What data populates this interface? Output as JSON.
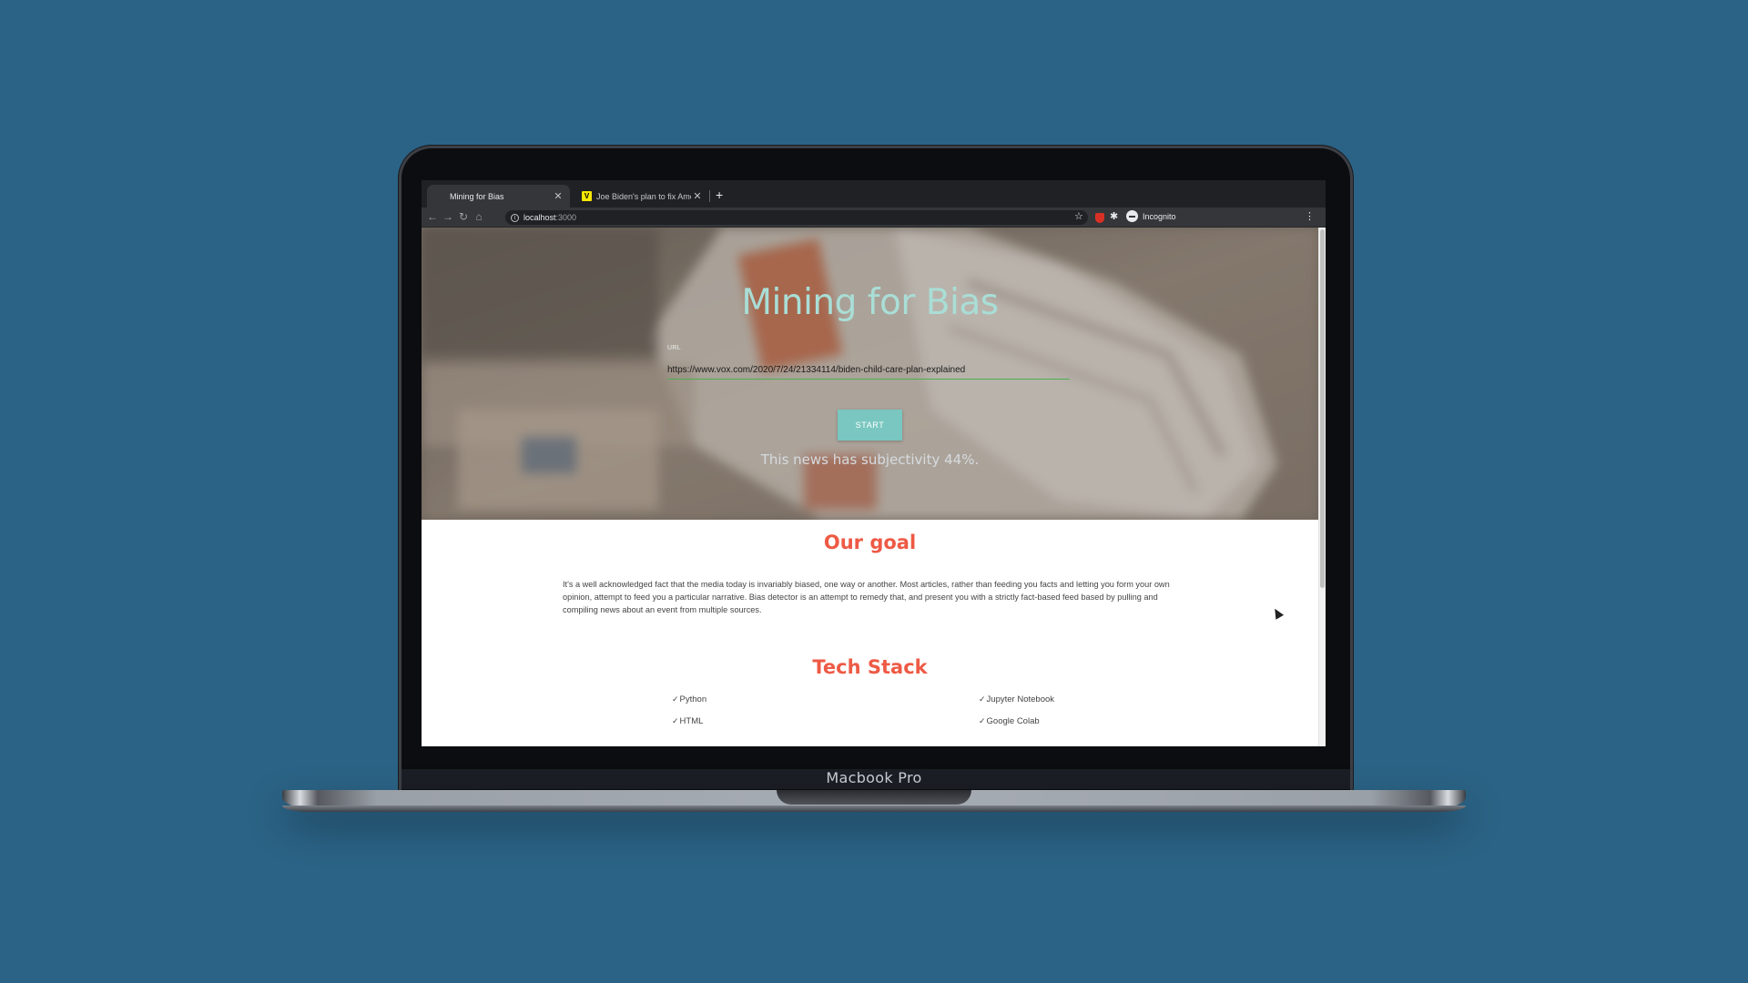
{
  "device": {
    "label": "Macbook Pro"
  },
  "browser": {
    "tabs": [
      {
        "title": "Mining for Bias",
        "active": true
      },
      {
        "title": "Joe Biden's plan to fix America's",
        "favicon": "vox-icon",
        "active": false
      }
    ],
    "address": {
      "host": "localhost",
      "port": ":3000"
    },
    "profile_label": "Incognito"
  },
  "hero": {
    "title": "Mining for Bias",
    "url_label": "URL",
    "url_value": "https://www.vox.com/2020/7/24/21334114/biden-child-care-plan-explained",
    "start_label": "START",
    "result": "This news has subjectivity 44%."
  },
  "goal": {
    "title": "Our goal",
    "text": "It's a well acknowledged fact that the media today is invariably biased, one way or another. Most articles, rather than feeding you facts and letting you form your own opinion, attempt to feed you a particular narrative. Bias detector is an attempt to remedy that, and present you with a strictly fact-based feed based by pulling and compiling news about an event from multiple sources."
  },
  "tech_stack": {
    "title": "Tech Stack",
    "items": [
      "Python",
      "Jupyter Notebook",
      "HTML",
      "Google Colab"
    ]
  },
  "colors": {
    "background": "#2b6386",
    "hero_title": "#a9ded6",
    "accent_button": "#79c7c0",
    "section_title": "#ee5a45",
    "input_underline": "#4caf50"
  }
}
